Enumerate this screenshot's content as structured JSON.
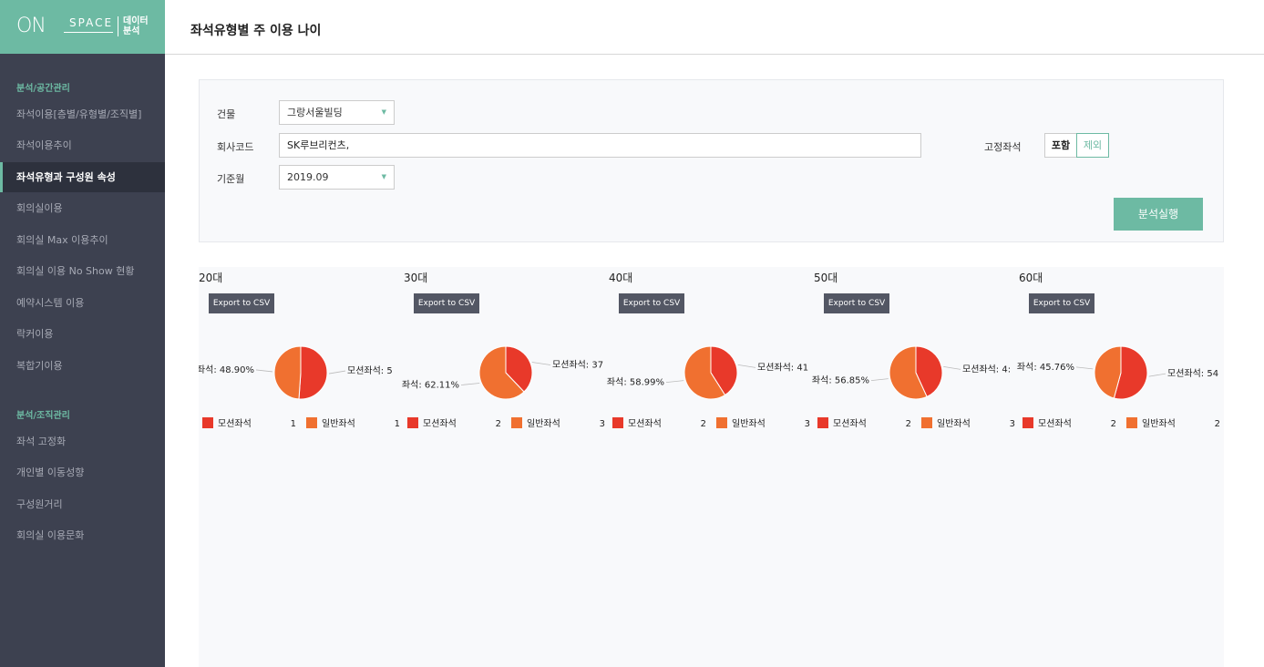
{
  "logo": {
    "on": "ON",
    "space": "SPACE",
    "tag_line1": "데이터",
    "tag_line2": "분석"
  },
  "sidebar": {
    "section1": "분석/공간관리",
    "items1": [
      "좌석이용[층별/유형별/조직별]",
      "좌석이용추이",
      "좌석유형과 구성원 속성",
      "회의실이용",
      "회의실 Max 이용추이",
      "회의실 이용 No Show 현황",
      "예약시스템 이용",
      "락커이용",
      "복합기이용"
    ],
    "section2": "분석/조직관리",
    "items2": [
      "좌석 고정화",
      "개인별 이동성향",
      "구성원거리",
      "회의실 이용문화"
    ],
    "active": "좌석유형과 구성원 속성"
  },
  "header": {
    "title": "좌석유형별 주 이용 나이"
  },
  "filters": {
    "building_label": "건물",
    "building_value": "그랑서울빌딩",
    "company_label": "회사코드",
    "company_value": "SK루브리컨츠,",
    "month_label": "기준월",
    "month_value": "2019.09",
    "fixed_label": "고정좌석",
    "include": "포함",
    "exclude": "제외",
    "run": "분석실행"
  },
  "export_label": "Export to CSV",
  "colors": {
    "accent": "#6dbaa3",
    "mobile_seat": "#e8392a",
    "general_seat": "#f07030"
  },
  "chart_data": [
    {
      "type": "pie",
      "title": "20대",
      "slices": [
        {
          "name": "모션좌석",
          "value": 51.1,
          "label": "모션좌석: 5"
        },
        {
          "name": "일반좌석",
          "value": 48.9,
          "label": "좌석: 48.90%"
        }
      ],
      "legend": [
        {
          "name": "모션좌석",
          "count": "1"
        },
        {
          "name": "일반좌석",
          "count": "1"
        }
      ]
    },
    {
      "type": "pie",
      "title": "30대",
      "slices": [
        {
          "name": "모션좌석",
          "value": 37.89,
          "label": "모션좌석: 37"
        },
        {
          "name": "일반좌석",
          "value": 62.11,
          "label": "좌석: 62.11%"
        }
      ],
      "legend": [
        {
          "name": "모션좌석",
          "count": "2"
        },
        {
          "name": "일반좌석",
          "count": "3"
        }
      ]
    },
    {
      "type": "pie",
      "title": "40대",
      "slices": [
        {
          "name": "모션좌석",
          "value": 41.01,
          "label": "모션좌석: 41"
        },
        {
          "name": "일반좌석",
          "value": 58.99,
          "label": "좌석: 58.99%"
        }
      ],
      "legend": [
        {
          "name": "모션좌석",
          "count": "2"
        },
        {
          "name": "일반좌석",
          "count": "3"
        }
      ]
    },
    {
      "type": "pie",
      "title": "50대",
      "slices": [
        {
          "name": "모션좌석",
          "value": 43.15,
          "label": "모션좌석: 4:"
        },
        {
          "name": "일반좌석",
          "value": 56.85,
          "label": "좌석: 56.85%"
        }
      ],
      "legend": [
        {
          "name": "모션좌석",
          "count": "2"
        },
        {
          "name": "일반좌석",
          "count": "3"
        }
      ]
    },
    {
      "type": "pie",
      "title": "60대",
      "slices": [
        {
          "name": "모션좌석",
          "value": 54.24,
          "label": "모션좌석: 54"
        },
        {
          "name": "일반좌석",
          "value": 45.76,
          "label": "좌석: 45.76%"
        }
      ],
      "legend": [
        {
          "name": "모션좌석",
          "count": "2"
        },
        {
          "name": "일반좌석",
          "count": "2"
        }
      ]
    }
  ]
}
